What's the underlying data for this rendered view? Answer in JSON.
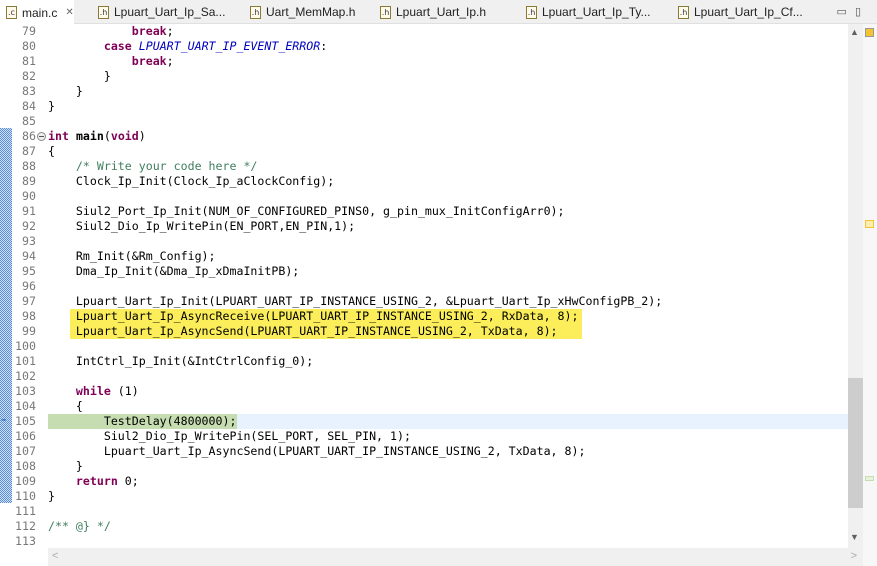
{
  "tabs": [
    {
      "label": "main.c",
      "active": true,
      "icon": ".c"
    },
    {
      "label": "Lpuart_Uart_Ip_Sa...",
      "icon": ".h"
    },
    {
      "label": "Uart_MemMap.h",
      "icon": ".h"
    },
    {
      "label": "Lpuart_Uart_Ip.h",
      "icon": ".h"
    },
    {
      "label": "Lpuart_Uart_Ip_Ty...",
      "icon": ".h"
    },
    {
      "label": "Lpuart_Uart_Ip_Cf...",
      "icon": ".h"
    }
  ],
  "colors": {
    "highlight": "#fbee5a",
    "current_line": "#c6dcb1",
    "keyword": "#7f0055",
    "comment": "#3f7f5f",
    "macro": "#0000c0"
  },
  "editor": {
    "highlighted_lines": [
      98,
      99
    ],
    "current_line": 105,
    "lines": [
      {
        "n": "79",
        "s": [
          [
            "p",
            "            "
          ],
          [
            "k",
            "break"
          ],
          [
            "p",
            ";"
          ]
        ]
      },
      {
        "n": "80",
        "s": [
          [
            "p",
            "        "
          ],
          [
            "k",
            "case"
          ],
          [
            "p",
            " "
          ],
          [
            "m",
            "LPUART_UART_IP_EVENT_ERROR"
          ],
          [
            "p",
            ":"
          ]
        ]
      },
      {
        "n": "81",
        "s": [
          [
            "p",
            "            "
          ],
          [
            "k",
            "break"
          ],
          [
            "p",
            ";"
          ]
        ]
      },
      {
        "n": "82",
        "s": [
          [
            "p",
            "        }"
          ]
        ]
      },
      {
        "n": "83",
        "s": [
          [
            "p",
            "    }"
          ]
        ]
      },
      {
        "n": "84",
        "s": [
          [
            "p",
            "}"
          ]
        ]
      },
      {
        "n": "85",
        "s": []
      },
      {
        "n": "86",
        "fold": true,
        "s": [
          [
            "k",
            "int"
          ],
          [
            "p",
            " "
          ],
          [
            "b",
            "main"
          ],
          [
            "p",
            "("
          ],
          [
            "k",
            "void"
          ],
          [
            "p",
            ")"
          ]
        ]
      },
      {
        "n": "87",
        "s": [
          [
            "p",
            "{"
          ]
        ]
      },
      {
        "n": "88",
        "s": [
          [
            "p",
            "    "
          ],
          [
            "c",
            "/* Write your code here */"
          ]
        ]
      },
      {
        "n": "89",
        "s": [
          [
            "p",
            "    Clock_Ip_Init(Clock_Ip_aClockConfig);"
          ]
        ]
      },
      {
        "n": "90",
        "s": []
      },
      {
        "n": "91",
        "s": [
          [
            "p",
            "    Siul2_Port_Ip_Init(NUM_OF_CONFIGURED_PINS0, g_pin_mux_InitConfigArr0);"
          ]
        ]
      },
      {
        "n": "92",
        "s": [
          [
            "p",
            "    Siul2_Dio_Ip_WritePin(EN_PORT,EN_PIN,1);"
          ]
        ]
      },
      {
        "n": "93",
        "s": []
      },
      {
        "n": "94",
        "s": [
          [
            "p",
            "    Rm_Init(&Rm_Config);"
          ]
        ]
      },
      {
        "n": "95",
        "s": [
          [
            "p",
            "    Dma_Ip_Init(&Dma_Ip_xDmaInitPB);"
          ]
        ]
      },
      {
        "n": "96",
        "s": []
      },
      {
        "n": "97",
        "s": [
          [
            "p",
            "    Lpuart_Uart_Ip_Init(LPUART_UART_IP_INSTANCE_USING_2, &Lpuart_Uart_Ip_xHwConfigPB_2);"
          ]
        ]
      },
      {
        "n": "98",
        "s": [
          [
            "p",
            "    Lpuart_Uart_Ip_AsyncReceive(LPUART_UART_IP_INSTANCE_USING_2, RxData, 8);"
          ]
        ]
      },
      {
        "n": "99",
        "s": [
          [
            "p",
            "    Lpuart_Uart_Ip_AsyncSend(LPUART_UART_IP_INSTANCE_USING_2, TxData, 8);"
          ]
        ]
      },
      {
        "n": "100",
        "s": []
      },
      {
        "n": "101",
        "s": [
          [
            "p",
            "    IntCtrl_Ip_Init(&IntCtrlConfig_0);"
          ]
        ]
      },
      {
        "n": "102",
        "s": []
      },
      {
        "n": "103",
        "s": [
          [
            "p",
            "    "
          ],
          [
            "k",
            "while"
          ],
          [
            "p",
            " (1)"
          ]
        ]
      },
      {
        "n": "104",
        "s": [
          [
            "p",
            "    {"
          ]
        ]
      },
      {
        "n": "105",
        "s": [
          [
            "p",
            "        TestDelay(4800000);"
          ]
        ]
      },
      {
        "n": "106",
        "s": [
          [
            "p",
            "        Siul2_Dio_Ip_WritePin(SEL_PORT, SEL_PIN, 1);"
          ]
        ]
      },
      {
        "n": "107",
        "s": [
          [
            "p",
            "        Lpuart_Uart_Ip_AsyncSend(LPUART_UART_IP_INSTANCE_USING_2, TxData, 8);"
          ]
        ]
      },
      {
        "n": "108",
        "s": [
          [
            "p",
            "    }"
          ]
        ]
      },
      {
        "n": "109",
        "s": [
          [
            "p",
            "    "
          ],
          [
            "k",
            "return"
          ],
          [
            "p",
            " 0;"
          ]
        ]
      },
      {
        "n": "110",
        "s": [
          [
            "p",
            "}"
          ]
        ]
      },
      {
        "n": "111",
        "s": []
      },
      {
        "n": "112",
        "s": [
          [
            "c",
            "/** @} */"
          ]
        ]
      },
      {
        "n": "113",
        "s": []
      }
    ]
  }
}
